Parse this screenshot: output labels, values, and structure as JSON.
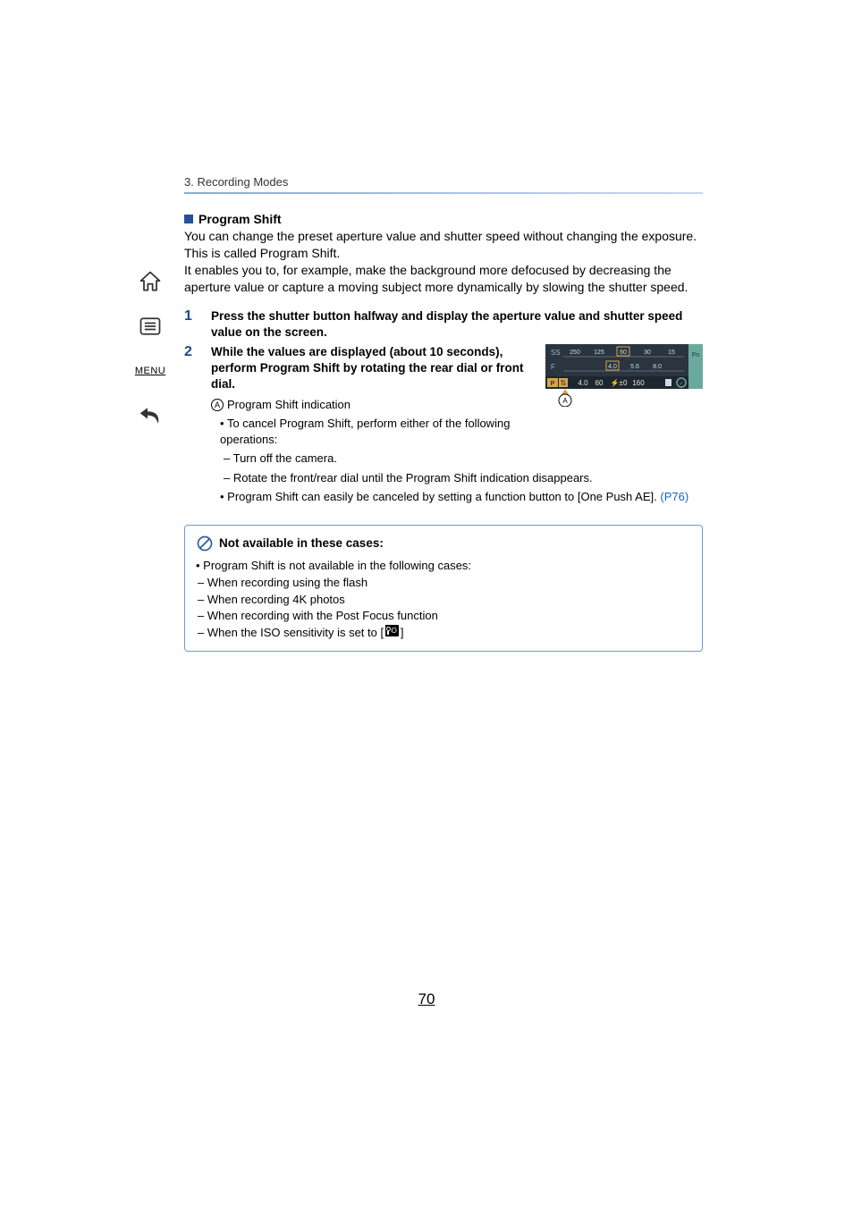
{
  "header": {
    "chapter": "3. Recording Modes"
  },
  "sidebar": {
    "menu_label": "MENU"
  },
  "program_shift": {
    "title": "Program Shift",
    "para1": "You can change the preset aperture value and shutter speed without changing the exposure. This is called Program Shift.",
    "para2": "It enables you to, for example, make the background more defocused by decreasing the aperture value or capture a moving subject more dynamically by slowing the shutter speed."
  },
  "steps": {
    "s1_num": "1",
    "s1": "Press the shutter button halfway and display the aperture value and shutter speed value on the screen.",
    "s2_num": "2",
    "s2": "While the values are displayed (about 10 seconds), perform Program Shift by rotating the rear dial or front dial.",
    "s2_a_letter": "A",
    "s2_a": "Program Shift indication",
    "s2_b": "To cancel Program Shift, perform either of the following operations:",
    "s2_b1": "Turn off the camera.",
    "s2_b2": "Rotate the front/rear dial until the Program Shift indication disappears.",
    "s2_c_pre": "Program Shift can easily be canceled by setting a function button to [One Push AE]. ",
    "s2_c_link": "(P76)"
  },
  "display": {
    "ss_label": "SS",
    "f_label": "F",
    "ss_ticks": [
      "250",
      "125",
      "60",
      "30",
      "15"
    ],
    "f_ticks": [
      "4.0",
      "5.6",
      "8.0"
    ],
    "mode_icon": "P",
    "shift_icon": "⇅",
    "bottom_values": [
      "4.0",
      "60"
    ],
    "ev": "±0",
    "iso": "160",
    "fn": "Fn",
    "callout": "A"
  },
  "note": {
    "title": "Not available in these cases:",
    "lead": "Program Shift is not available in the following cases:",
    "i1": "When recording using the flash",
    "i2": "When recording 4K photos",
    "i3": "When recording with the Post Focus function",
    "i4_pre": "When the ISO sensitivity is set to [",
    "i4_iso": "ISO",
    "i4_post": "]"
  },
  "page_number": "70"
}
